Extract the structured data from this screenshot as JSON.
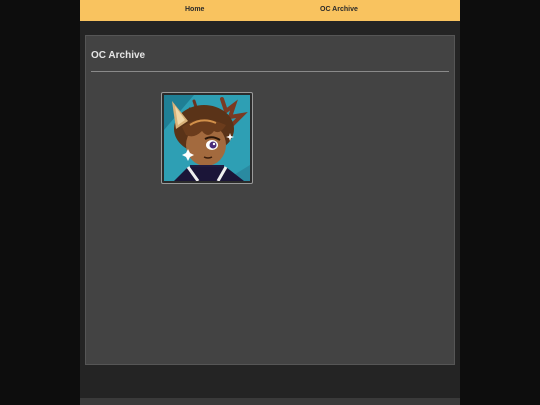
{
  "nav": {
    "home_label": "Home",
    "archive_label": "OC Archive"
  },
  "main": {
    "title": "OC Archive",
    "gallery": [
      {
        "icon": "character-portrait-image"
      }
    ]
  },
  "colors": {
    "nav_bar": "#f9c35f",
    "panel": "#434343",
    "page_background": "#0d0d0d",
    "frame": "#242424"
  }
}
